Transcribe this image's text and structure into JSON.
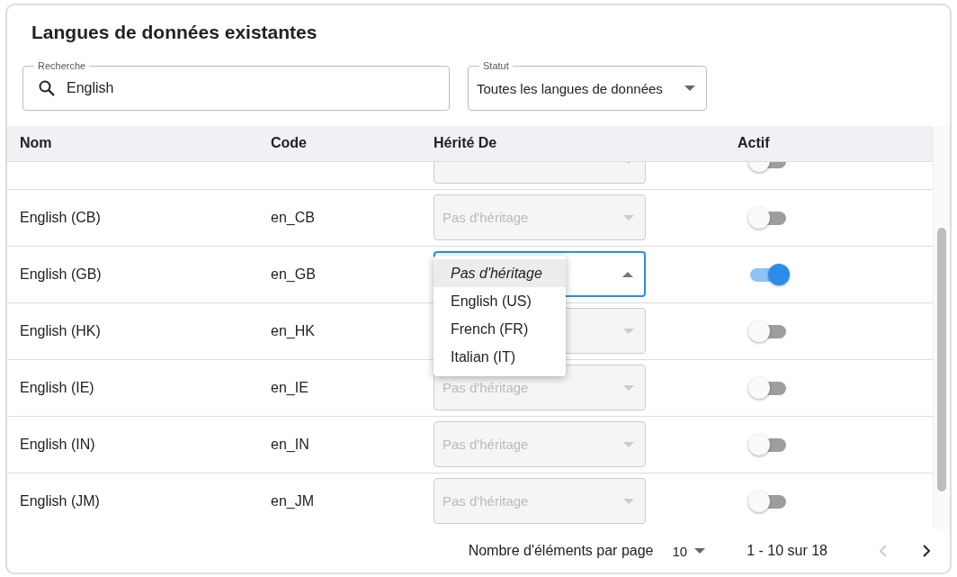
{
  "title": "Langues de données existantes",
  "search": {
    "label": "Recherche",
    "value": "English"
  },
  "status": {
    "label": "Statut",
    "value": "Toutes les langues de données"
  },
  "table": {
    "columns": [
      "Nom",
      "Code",
      "Hérité De",
      "Actif"
    ],
    "rows": [
      {
        "disabled": true,
        "open": false,
        "on": false
      },
      {
        "name": "English (CB)",
        "code": "en_CB",
        "inherit": "Pas d'héritage",
        "disabled": true,
        "open": false,
        "on": false
      },
      {
        "name": "English (GB)",
        "code": "en_GB",
        "disabled": false,
        "open": true,
        "on": true
      },
      {
        "name": "English (HK)",
        "code": "en_HK",
        "disabled": true,
        "open": false,
        "on": false
      },
      {
        "name": "English (IE)",
        "code": "en_IE",
        "inherit": "Pas d'héritage",
        "disabled": true,
        "open": false,
        "on": false
      },
      {
        "name": "English (IN)",
        "code": "en_IN",
        "inherit": "Pas d'héritage",
        "disabled": true,
        "open": false,
        "on": false
      },
      {
        "name": "English (JM)",
        "code": "en_JM",
        "inherit": "Pas d'héritage",
        "disabled": true,
        "open": false,
        "on": false
      }
    ]
  },
  "menu": [
    {
      "label": "Pas d'héritage",
      "selected": true
    },
    {
      "label": "English (US)",
      "selected": false
    },
    {
      "label": "French (FR)",
      "selected": false
    },
    {
      "label": "Italian (IT)",
      "selected": false
    }
  ],
  "pagination": {
    "label": "Nombre d'éléments par page",
    "page_size": "10",
    "range": "1 - 10 sur 18",
    "prev_disabled": true,
    "next_disabled": false
  }
}
